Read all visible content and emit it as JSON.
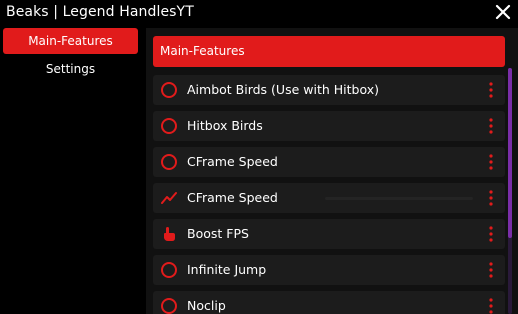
{
  "window": {
    "title": "Beaks | Legend HandlesYT"
  },
  "sidebar": {
    "items": [
      {
        "label": "Main-Features",
        "active": true
      },
      {
        "label": "Settings",
        "active": false
      }
    ]
  },
  "main": {
    "header": "Main-Features",
    "rows": [
      {
        "label": "Aimbot Birds (Use with Hitbox)",
        "icon": "toggle-ring-icon"
      },
      {
        "label": "Hitbox Birds",
        "icon": "toggle-ring-icon"
      },
      {
        "label": "CFrame Speed",
        "icon": "toggle-ring-icon"
      },
      {
        "label": "CFrame Speed",
        "icon": "trend-line-icon"
      },
      {
        "label": "Boost FPS",
        "icon": "hand-pointer-icon"
      },
      {
        "label": "Infinite Jump",
        "icon": "toggle-ring-icon"
      },
      {
        "label": "Noclip",
        "icon": "toggle-ring-icon"
      }
    ]
  },
  "colors": {
    "accent": "#e11b1b",
    "scrollbar": "#7a2ea8",
    "row_bg": "#1c1c1c",
    "panel_bg": "#111111"
  }
}
